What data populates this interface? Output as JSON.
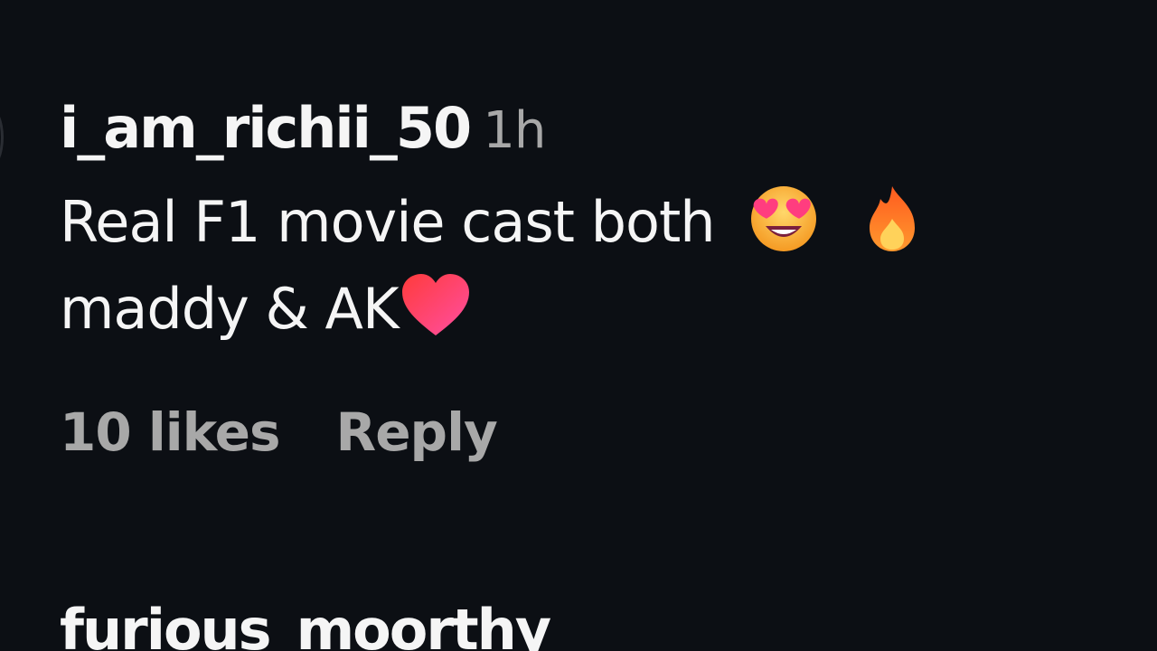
{
  "comment": {
    "username": "i_am_richii_50",
    "timestamp": "1h",
    "text_line1": "Real F1 movie cast both",
    "emoji1": "star-struck-heart-eyes-emoji",
    "emoji2": "fire-emoji",
    "text_line2": "maddy & AK",
    "emoji3": "heart-emoji",
    "likes": "10 likes",
    "reply_label": "Reply"
  },
  "next_comment": {
    "username": "furious_moorthy"
  },
  "colors": {
    "background": "#0c0f14",
    "primary_text": "#f5f5f5",
    "secondary_text": "#a8a8a8"
  }
}
